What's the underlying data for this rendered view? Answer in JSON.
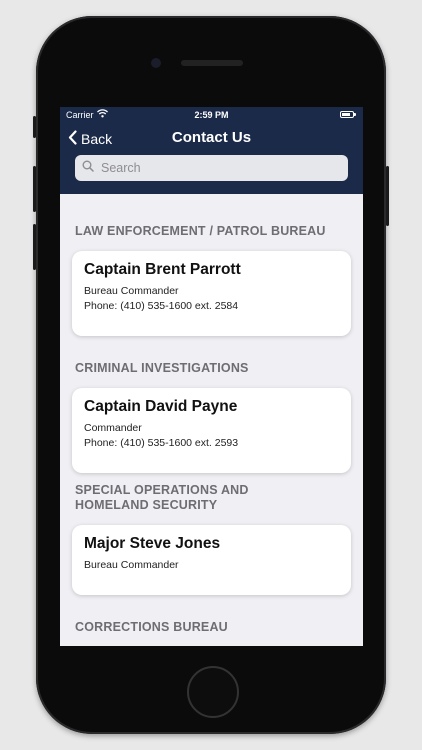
{
  "status_bar": {
    "carrier": "Carrier",
    "time": "2:59 PM"
  },
  "navbar": {
    "back_label": "Back",
    "title": "Contact Us"
  },
  "search": {
    "placeholder": "Search"
  },
  "sections": [
    {
      "header": "LAW ENFORCEMENT / PATROL BUREAU",
      "card": {
        "name": "Captain Brent Parrott",
        "role": "Bureau Commander",
        "phone": "Phone: (410) 535-1600 ext. 2584"
      }
    },
    {
      "header": "CRIMINAL INVESTIGATIONS",
      "card": {
        "name": "Captain David Payne",
        "role": "Commander",
        "phone": "Phone: (410) 535-1600 ext. 2593"
      }
    },
    {
      "header_line1": "SPECIAL OPERATIONS AND",
      "header_line2": "HOMELAND SECURITY",
      "card": {
        "name": "Major Steve Jones",
        "role": "Bureau Commander"
      }
    },
    {
      "header": "CORRECTIONS BUREAU"
    }
  ],
  "colors": {
    "navbar": "#1c2a4a",
    "background": "#efeff4",
    "header_text": "#6d6d72"
  },
  "icons": [
    "wifi-icon",
    "battery-icon",
    "chevron-left-icon",
    "search-icon"
  ]
}
